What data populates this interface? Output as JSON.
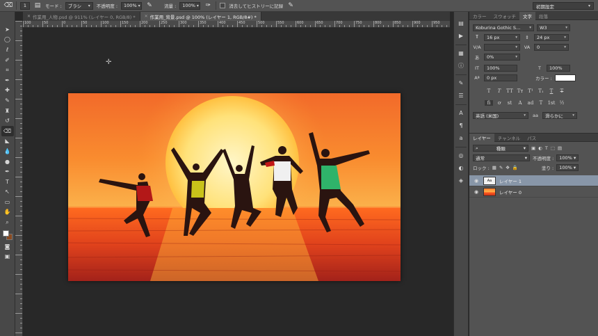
{
  "options_bar": {
    "mode_label": "モード :",
    "mode_value": "ブラシ",
    "opacity_label": "不透明度 :",
    "opacity_value": "100%",
    "flow_label": "流量 :",
    "flow_value": "100%",
    "erase_history_label": "消去してヒストリーに記録",
    "brush_size": "1",
    "workspace_preset": "初期設定"
  },
  "tabs": [
    {
      "label": "作業用_人物.psd @ 911% (レイヤー 0, RGB/8) *",
      "active": false
    },
    {
      "label": "作業用_背景.psd @ 100% (レイヤー 1, RGB/8#) *",
      "active": true
    }
  ],
  "ruler": {
    "top_numbers": [
      "100",
      "50",
      "0",
      "50",
      "100",
      "150",
      "200",
      "250",
      "300",
      "350",
      "400",
      "450",
      "500",
      "550",
      "600",
      "650",
      "700",
      "750",
      "800",
      "850",
      "900",
      "950"
    ]
  },
  "right_panel": {
    "top_tabs": [
      {
        "label": "カラー",
        "active": false
      },
      {
        "label": "スウォッチ",
        "active": false
      },
      {
        "label": "文字",
        "active": true
      },
      {
        "label": "段落",
        "active": false
      }
    ],
    "character": {
      "font_family": "Koburina Gothic S...",
      "font_style": "W3",
      "font_size": "16 px",
      "leading": "24 px",
      "kerning": "",
      "tracking": "0",
      "tsume": "0%",
      "vertical_scale": "100%",
      "horizontal_scale": "100%",
      "baseline_shift": "0 px",
      "color_label": "カラー :",
      "color_value": "#ffffff",
      "style_buttons": [
        "T",
        "T",
        "TT",
        "Tт",
        "T¹",
        "T₁",
        "T",
        "T"
      ],
      "opentype_buttons": [
        "fi",
        "ơ",
        "st",
        "A",
        "ad",
        "T",
        "1st",
        "½"
      ],
      "language": "英語 (米国)",
      "antialias_icon": "aa",
      "antialias": "滑らかに"
    },
    "layers_tabs": [
      {
        "label": "レイヤー",
        "active": true
      },
      {
        "label": "チャンネル",
        "active": false
      },
      {
        "label": "パス",
        "active": false
      }
    ],
    "layers": {
      "filter_kind": "種類",
      "blend_mode": "通常",
      "opacity_label": "不透明度 :",
      "opacity_value": "100%",
      "lock_label": "ロック :",
      "fill_label": "塗り :",
      "fill_value": "100%",
      "items": [
        {
          "name": "レイヤー 1",
          "selected": true,
          "thumb": "text"
        },
        {
          "name": "レイヤー 0",
          "selected": false,
          "thumb": "image"
        }
      ]
    }
  },
  "colors": {
    "accent_selected_layer": "#8896a8",
    "foreground": "#ffffff",
    "background": "#8a4a20"
  }
}
